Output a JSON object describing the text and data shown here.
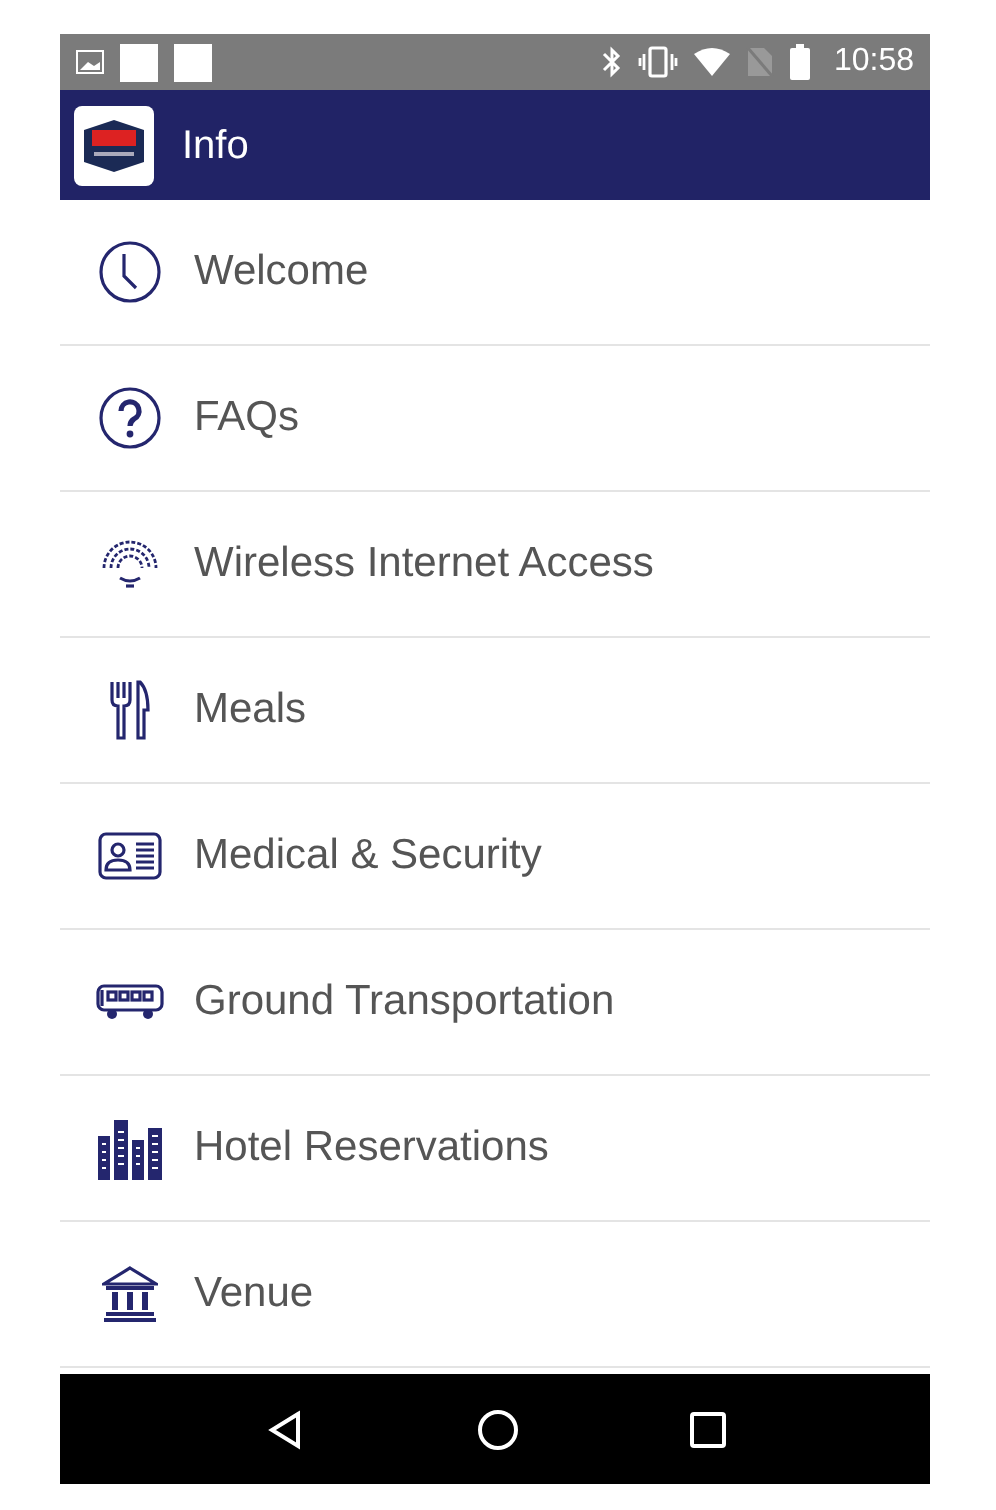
{
  "status_bar": {
    "time": "10:58"
  },
  "header": {
    "title": "Info"
  },
  "menu": [
    {
      "label": "Welcome",
      "kind": "clock"
    },
    {
      "label": "FAQs",
      "kind": "question"
    },
    {
      "label": "Wireless Internet Access",
      "kind": "wifi"
    },
    {
      "label": "Meals",
      "kind": "meals"
    },
    {
      "label": "Medical & Security",
      "kind": "badge"
    },
    {
      "label": "Ground Transportation",
      "kind": "bus"
    },
    {
      "label": "Hotel Reservations",
      "kind": "buildings"
    },
    {
      "label": "Venue",
      "kind": "venue"
    }
  ]
}
